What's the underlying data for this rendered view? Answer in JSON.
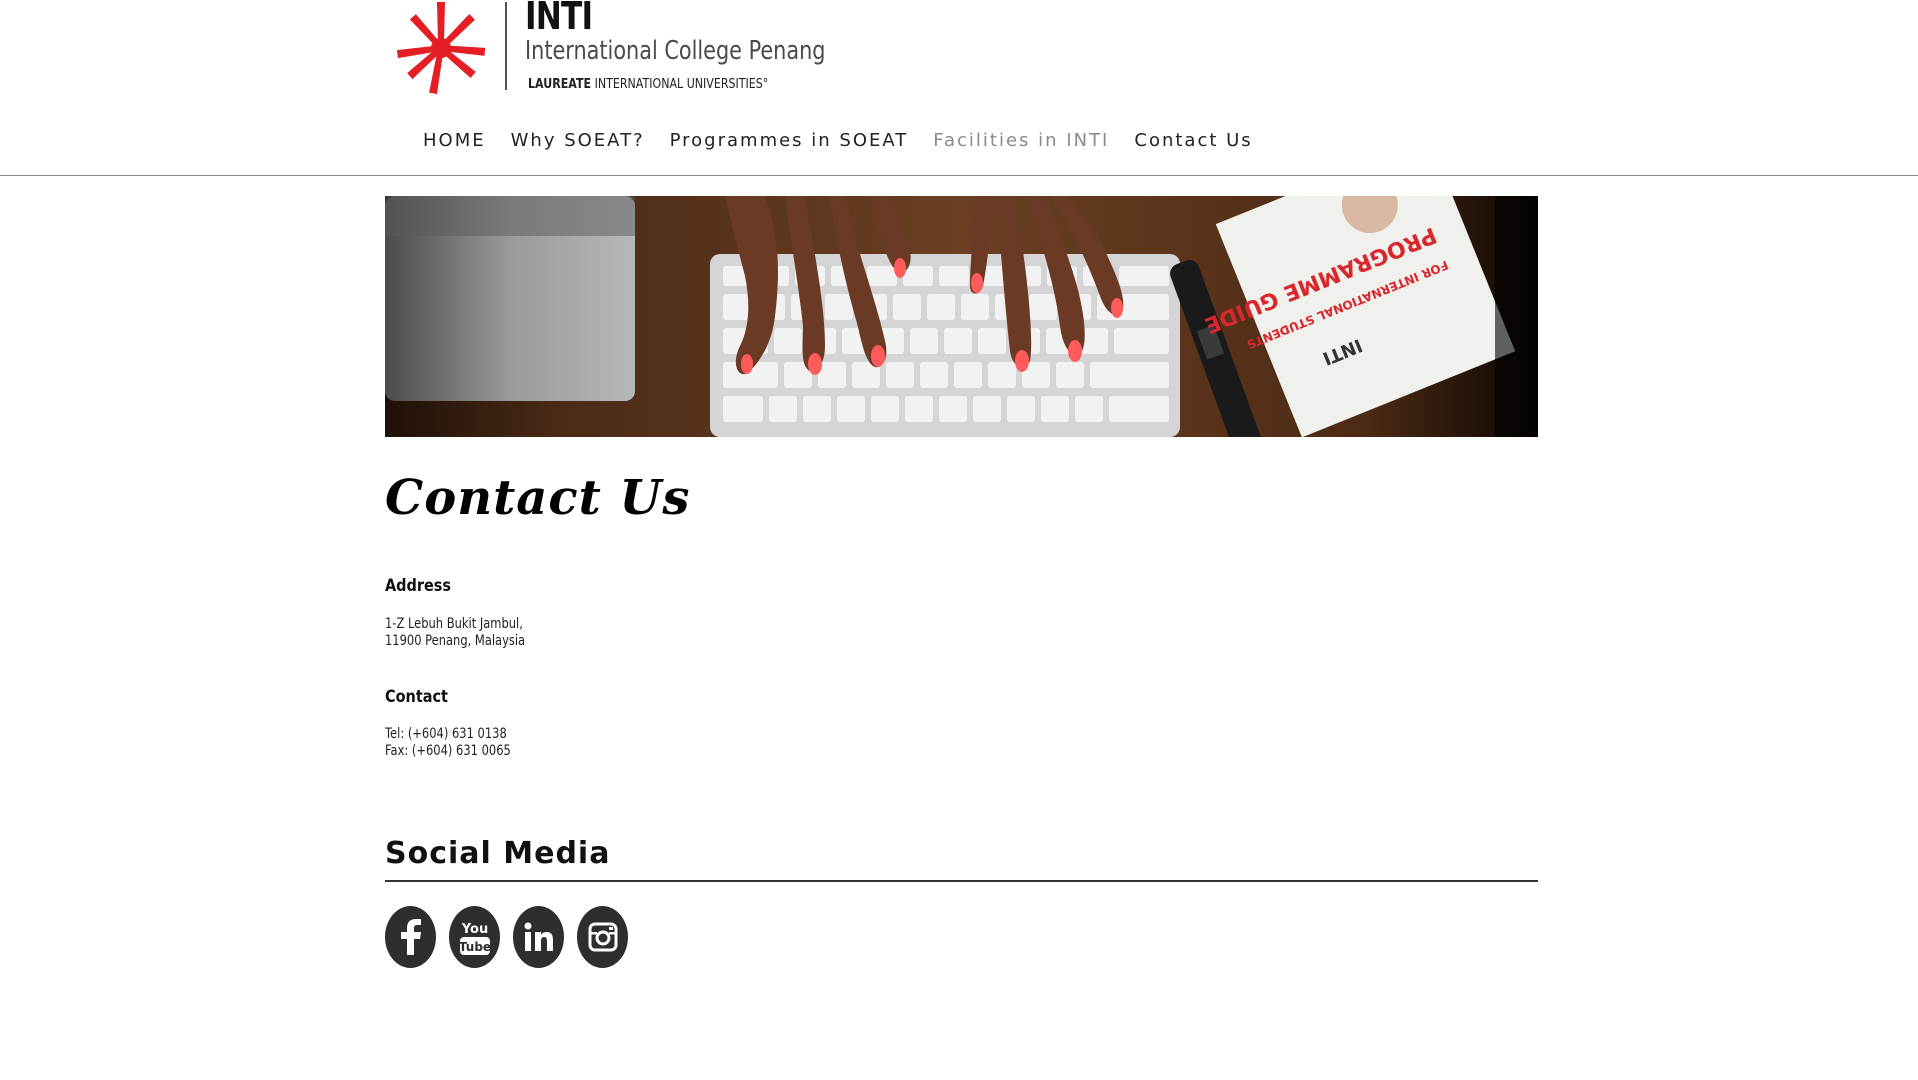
{
  "header": {
    "logo": {
      "brand": "INTI",
      "college": "International College Penang",
      "network_bold": "LAUREATE",
      "network_rest": "INTERNATIONAL UNIVERSITIES°"
    },
    "nav": [
      {
        "label": "HOME",
        "active": false
      },
      {
        "label": "Why SOEAT?",
        "active": false
      },
      {
        "label": "Programmes in SOEAT",
        "active": false
      },
      {
        "label": "Facilities in INTI",
        "active": true
      },
      {
        "label": "Contact Us",
        "active": false
      }
    ]
  },
  "banner": {
    "guide_title": "PROGRAMME GUIDE",
    "guide_subtitle": "FOR INTERNATIONAL STUDENTS",
    "guide_brand": "INTI"
  },
  "content": {
    "title": "Contact Us",
    "address": {
      "heading": "Address",
      "line1": "1-Z Lebuh Bukit Jambul,",
      "line2": "11900 Penang, Malaysia"
    },
    "contact": {
      "heading": "Contact",
      "tel": "Tel: (+604) 631 0138",
      "fax": "Fax: (+604) 631 0065"
    }
  },
  "social": {
    "title": "Social Media",
    "icons": [
      "facebook-icon",
      "youtube-icon",
      "linkedin-icon",
      "instagram-icon"
    ],
    "youtube_you": "You",
    "youtube_tube": "Tube"
  },
  "colors": {
    "brand_red": "#e31e24",
    "nav_active": "#8a8a8a",
    "icon_bg": "#2e2e2e"
  }
}
